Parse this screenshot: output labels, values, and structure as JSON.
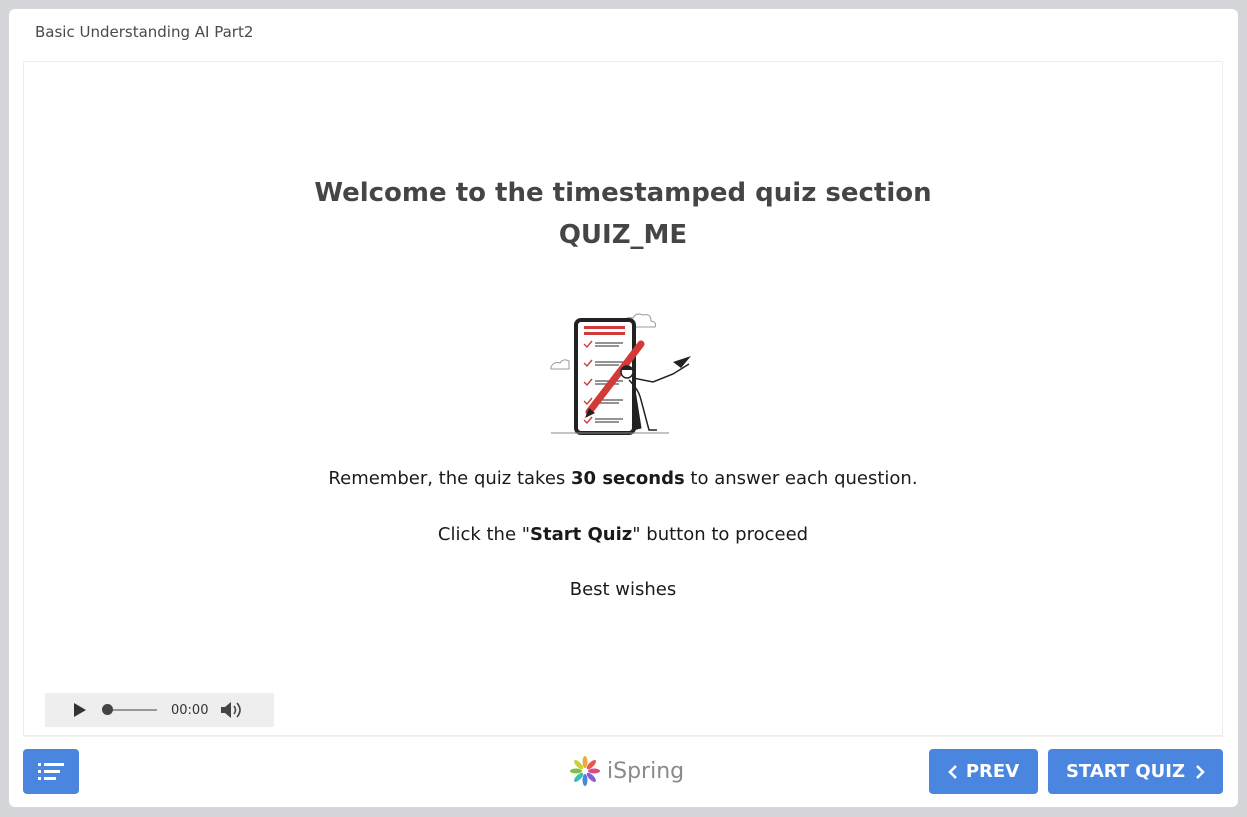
{
  "window": {
    "title": "Basic Understanding AI Part2"
  },
  "slide": {
    "heading_line1": "Welcome to the timestamped quiz section",
    "heading_line2": "QUIZ_ME",
    "illustration_icon": "quiz-checklist-illustration",
    "para1": {
      "before": "Remember, the quiz takes ",
      "bold": "30 seconds",
      "after": " to answer each question."
    },
    "para2": {
      "before": "Click the \"",
      "bold": "Start Quiz",
      "after": "\" button to proceed"
    },
    "para3": "Best wishes"
  },
  "audio": {
    "time": "00:00",
    "progress": 0
  },
  "footer": {
    "logo_text": "iSpring",
    "prev_label": "PREV",
    "start_label": "START QUIZ"
  },
  "colors": {
    "accent": "#4a86e0",
    "heading": "#454545",
    "background": "#d4d6d9"
  }
}
